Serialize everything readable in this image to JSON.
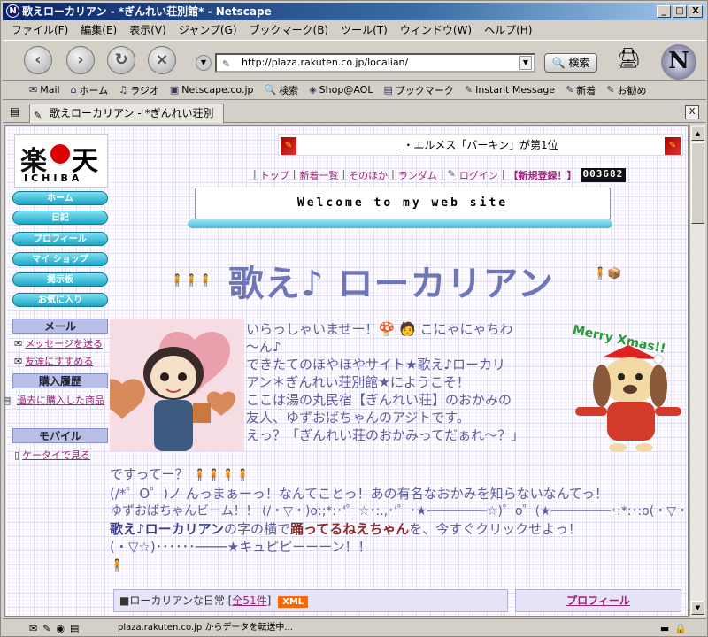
{
  "window": {
    "title": "歌えローカリアン - *ぎんれい荘別館* - Netscape",
    "min": "_",
    "max": "□",
    "close": "X"
  },
  "menu": [
    "ファイル(F)",
    "編集(E)",
    "表示(V)",
    "ジャンプ(G)",
    "ブックマーク(B)",
    "ツール(T)",
    "ウィンドウ(W)",
    "ヘルプ(H)"
  ],
  "nav": {
    "url": "http://plaza.rakuten.co.jp/localian/",
    "search_label": "検索"
  },
  "bookmarks": [
    "Mail",
    "ホーム",
    "ラジオ",
    "Netscape.co.jp",
    "検索",
    "Shop@AOL",
    "ブックマーク",
    "Instant Message",
    "新着",
    "お勧め"
  ],
  "tab": {
    "label": "歌えローカリアン - *ぎんれい荘別館*"
  },
  "sidebar": {
    "logo_left": "楽",
    "logo_right": "天",
    "logo_sub": "ICHIBA",
    "buttons": [
      "ホーム",
      "日記",
      "プロフィール",
      "マイ ショップ",
      "掲示板",
      "お気に入り"
    ],
    "mail_heading": "メール",
    "mail_links": [
      "メッセージを送る",
      "友達にすすめる"
    ],
    "history_heading": "購入履歴",
    "history_link": "過去に購入した商品",
    "mobile_heading": "モバイル",
    "mobile_link": "ケータイで見る"
  },
  "banner": {
    "text": "・エルメス「バーキン」が第1位"
  },
  "toplinks": {
    "items": [
      "トップ",
      "新着一覧",
      "そのほか",
      "ランダム"
    ],
    "login": "ログイン",
    "register": "【新規登録！】",
    "counter": "003682"
  },
  "welcome": "Welcome to my web site",
  "main_title": "歌え♪ ローカリアン",
  "intro": [
    "いらっしゃいませー！🍄 🧑 こにゃにゃちわ",
    "〜ん♪",
    "できたてのほやほやサイト★歌え♪ローカリ",
    "アン＊ぎんれい荘別館★にようこそ！",
    "ここは湯の丸民宿【ぎんれい荘】のおかみの",
    "友人、ゆずおばちゃんのアジトです。",
    "えっ？「ぎんれい荘のおかみってだぁれ〜？」"
  ],
  "body": {
    "l1": "ですってー？",
    "l2": "(/*゜O゜)ノ んっまぁーっ！なんてことっ！あの有名なおかみを知らないなんてっ！",
    "l3": "ゆずおばちゃんビーム！！ (/・▽・)o:;*:･'゜☆･:.,･'゜･★────────☆)゜o゜(★────────･:*:･:o(・▽・)",
    "l4a": "歌え♪ローカリアン",
    "l4b": "の字の横で",
    "l4c": "踊ってるねえちゃん",
    "l4d": "を、今すぐクリックせよっ！",
    "l5": "(・▽☆)･･････────★キュピピーーーン！！"
  },
  "diary": {
    "label": "■ローカリアンな日常",
    "count": "全51件",
    "xml": "XML"
  },
  "profile_label": "プロフィール",
  "xmas": "Merry Xmas!!",
  "status": {
    "text": "plaza.rakuten.co.jp からデータを転送中..."
  }
}
